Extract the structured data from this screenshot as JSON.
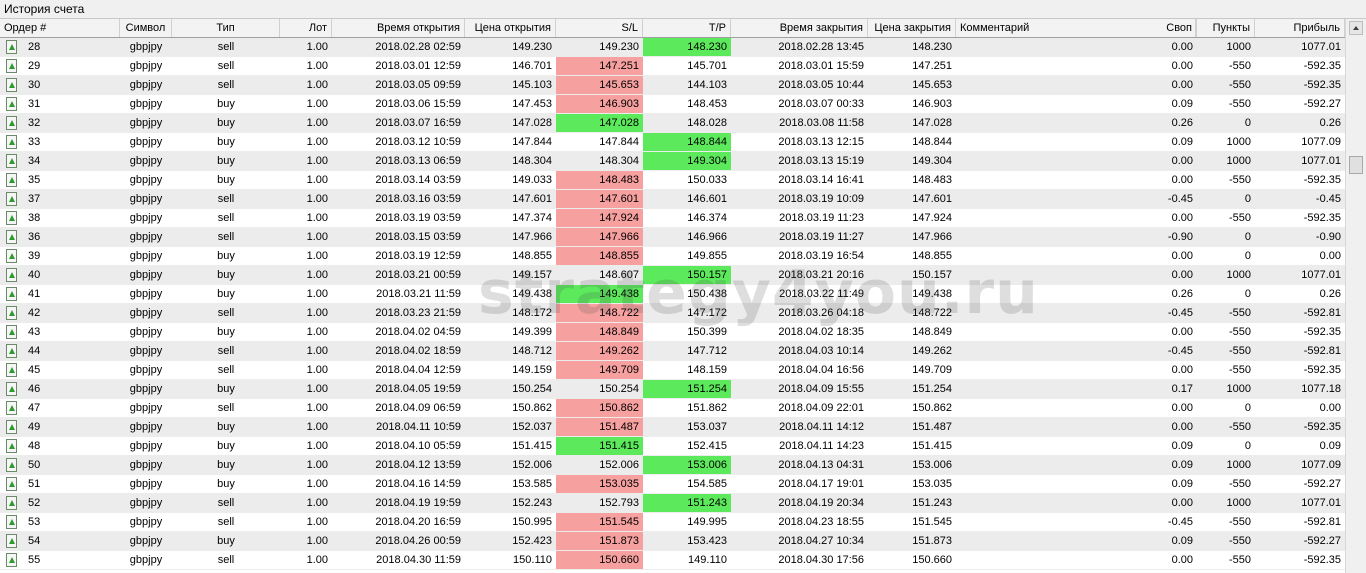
{
  "window": {
    "title": "История счета"
  },
  "columns": {
    "order": "Ордер #",
    "symbol": "Символ",
    "type": "Тип",
    "lot": "Лот",
    "open_time": "Время открытия",
    "open_price": "Цена открытия",
    "sl": "S/L",
    "tp": "T/P",
    "close_time": "Время закрытия",
    "close_price": "Цена закрытия",
    "comment": "Комментарий",
    "swap": "Своп",
    "points": "Пункты",
    "profit": "Прибыль"
  },
  "watermark": "strategy4you.ru",
  "colors": {
    "sl_hit": "#f7a0a0",
    "tp_hit": "#5cea5c",
    "alt_row": "#ececec"
  },
  "rows": [
    {
      "order": "28",
      "symbol": "gbpjpy",
      "type": "sell",
      "lot": "1.00",
      "open_time": "2018.02.28 02:59",
      "open_price": "149.230",
      "sl": "149.230",
      "tp": "148.230",
      "close_time": "2018.02.28 13:45",
      "close_price": "148.230",
      "comment": "",
      "swap": "0.00",
      "points": "1000",
      "profit": "1077.01",
      "sl_hl": "",
      "tp_hl": "green"
    },
    {
      "order": "29",
      "symbol": "gbpjpy",
      "type": "sell",
      "lot": "1.00",
      "open_time": "2018.03.01 12:59",
      "open_price": "146.701",
      "sl": "147.251",
      "tp": "145.701",
      "close_time": "2018.03.01 15:59",
      "close_price": "147.251",
      "comment": "",
      "swap": "0.00",
      "points": "-550",
      "profit": "-592.35",
      "sl_hl": "red",
      "tp_hl": ""
    },
    {
      "order": "30",
      "symbol": "gbpjpy",
      "type": "sell",
      "lot": "1.00",
      "open_time": "2018.03.05 09:59",
      "open_price": "145.103",
      "sl": "145.653",
      "tp": "144.103",
      "close_time": "2018.03.05 10:44",
      "close_price": "145.653",
      "comment": "",
      "swap": "0.00",
      "points": "-550",
      "profit": "-592.35",
      "sl_hl": "red",
      "tp_hl": ""
    },
    {
      "order": "31",
      "symbol": "gbpjpy",
      "type": "buy",
      "lot": "1.00",
      "open_time": "2018.03.06 15:59",
      "open_price": "147.453",
      "sl": "146.903",
      "tp": "148.453",
      "close_time": "2018.03.07 00:33",
      "close_price": "146.903",
      "comment": "",
      "swap": "0.09",
      "points": "-550",
      "profit": "-592.27",
      "sl_hl": "red",
      "tp_hl": ""
    },
    {
      "order": "32",
      "symbol": "gbpjpy",
      "type": "buy",
      "lot": "1.00",
      "open_time": "2018.03.07 16:59",
      "open_price": "147.028",
      "sl": "147.028",
      "tp": "148.028",
      "close_time": "2018.03.08 11:58",
      "close_price": "147.028",
      "comment": "",
      "swap": "0.26",
      "points": "0",
      "profit": "0.26",
      "sl_hl": "green",
      "tp_hl": ""
    },
    {
      "order": "33",
      "symbol": "gbpjpy",
      "type": "buy",
      "lot": "1.00",
      "open_time": "2018.03.12 10:59",
      "open_price": "147.844",
      "sl": "147.844",
      "tp": "148.844",
      "close_time": "2018.03.13 12:15",
      "close_price": "148.844",
      "comment": "",
      "swap": "0.09",
      "points": "1000",
      "profit": "1077.09",
      "sl_hl": "",
      "tp_hl": "green"
    },
    {
      "order": "34",
      "symbol": "gbpjpy",
      "type": "buy",
      "lot": "1.00",
      "open_time": "2018.03.13 06:59",
      "open_price": "148.304",
      "sl": "148.304",
      "tp": "149.304",
      "close_time": "2018.03.13 15:19",
      "close_price": "149.304",
      "comment": "",
      "swap": "0.00",
      "points": "1000",
      "profit": "1077.01",
      "sl_hl": "",
      "tp_hl": "green"
    },
    {
      "order": "35",
      "symbol": "gbpjpy",
      "type": "buy",
      "lot": "1.00",
      "open_time": "2018.03.14 03:59",
      "open_price": "149.033",
      "sl": "148.483",
      "tp": "150.033",
      "close_time": "2018.03.14 16:41",
      "close_price": "148.483",
      "comment": "",
      "swap": "0.00",
      "points": "-550",
      "profit": "-592.35",
      "sl_hl": "red",
      "tp_hl": ""
    },
    {
      "order": "37",
      "symbol": "gbpjpy",
      "type": "sell",
      "lot": "1.00",
      "open_time": "2018.03.16 03:59",
      "open_price": "147.601",
      "sl": "147.601",
      "tp": "146.601",
      "close_time": "2018.03.19 10:09",
      "close_price": "147.601",
      "comment": "",
      "swap": "-0.45",
      "points": "0",
      "profit": "-0.45",
      "sl_hl": "red",
      "tp_hl": ""
    },
    {
      "order": "38",
      "symbol": "gbpjpy",
      "type": "sell",
      "lot": "1.00",
      "open_time": "2018.03.19 03:59",
      "open_price": "147.374",
      "sl": "147.924",
      "tp": "146.374",
      "close_time": "2018.03.19 11:23",
      "close_price": "147.924",
      "comment": "",
      "swap": "0.00",
      "points": "-550",
      "profit": "-592.35",
      "sl_hl": "red",
      "tp_hl": ""
    },
    {
      "order": "36",
      "symbol": "gbpjpy",
      "type": "sell",
      "lot": "1.00",
      "open_time": "2018.03.15 03:59",
      "open_price": "147.966",
      "sl": "147.966",
      "tp": "146.966",
      "close_time": "2018.03.19 11:27",
      "close_price": "147.966",
      "comment": "",
      "swap": "-0.90",
      "points": "0",
      "profit": "-0.90",
      "sl_hl": "red",
      "tp_hl": ""
    },
    {
      "order": "39",
      "symbol": "gbpjpy",
      "type": "buy",
      "lot": "1.00",
      "open_time": "2018.03.19 12:59",
      "open_price": "148.855",
      "sl": "148.855",
      "tp": "149.855",
      "close_time": "2018.03.19 16:54",
      "close_price": "148.855",
      "comment": "",
      "swap": "0.00",
      "points": "0",
      "profit": "0.00",
      "sl_hl": "red",
      "tp_hl": ""
    },
    {
      "order": "40",
      "symbol": "gbpjpy",
      "type": "buy",
      "lot": "1.00",
      "open_time": "2018.03.21 00:59",
      "open_price": "149.157",
      "sl": "148.607",
      "tp": "150.157",
      "close_time": "2018.03.21 20:16",
      "close_price": "150.157",
      "comment": "",
      "swap": "0.00",
      "points": "1000",
      "profit": "1077.01",
      "sl_hl": "",
      "tp_hl": "green"
    },
    {
      "order": "41",
      "symbol": "gbpjpy",
      "type": "buy",
      "lot": "1.00",
      "open_time": "2018.03.21 11:59",
      "open_price": "149.438",
      "sl": "149.438",
      "tp": "150.438",
      "close_time": "2018.03.22 11:49",
      "close_price": "149.438",
      "comment": "",
      "swap": "0.26",
      "points": "0",
      "profit": "0.26",
      "sl_hl": "green",
      "tp_hl": ""
    },
    {
      "order": "42",
      "symbol": "gbpjpy",
      "type": "sell",
      "lot": "1.00",
      "open_time": "2018.03.23 21:59",
      "open_price": "148.172",
      "sl": "148.722",
      "tp": "147.172",
      "close_time": "2018.03.26 04:18",
      "close_price": "148.722",
      "comment": "",
      "swap": "-0.45",
      "points": "-550",
      "profit": "-592.81",
      "sl_hl": "red",
      "tp_hl": ""
    },
    {
      "order": "43",
      "symbol": "gbpjpy",
      "type": "buy",
      "lot": "1.00",
      "open_time": "2018.04.02 04:59",
      "open_price": "149.399",
      "sl": "148.849",
      "tp": "150.399",
      "close_time": "2018.04.02 18:35",
      "close_price": "148.849",
      "comment": "",
      "swap": "0.00",
      "points": "-550",
      "profit": "-592.35",
      "sl_hl": "red",
      "tp_hl": ""
    },
    {
      "order": "44",
      "symbol": "gbpjpy",
      "type": "sell",
      "lot": "1.00",
      "open_time": "2018.04.02 18:59",
      "open_price": "148.712",
      "sl": "149.262",
      "tp": "147.712",
      "close_time": "2018.04.03 10:14",
      "close_price": "149.262",
      "comment": "",
      "swap": "-0.45",
      "points": "-550",
      "profit": "-592.81",
      "sl_hl": "red",
      "tp_hl": ""
    },
    {
      "order": "45",
      "symbol": "gbpjpy",
      "type": "sell",
      "lot": "1.00",
      "open_time": "2018.04.04 12:59",
      "open_price": "149.159",
      "sl": "149.709",
      "tp": "148.159",
      "close_time": "2018.04.04 16:56",
      "close_price": "149.709",
      "comment": "",
      "swap": "0.00",
      "points": "-550",
      "profit": "-592.35",
      "sl_hl": "red",
      "tp_hl": ""
    },
    {
      "order": "46",
      "symbol": "gbpjpy",
      "type": "buy",
      "lot": "1.00",
      "open_time": "2018.04.05 19:59",
      "open_price": "150.254",
      "sl": "150.254",
      "tp": "151.254",
      "close_time": "2018.04.09 15:55",
      "close_price": "151.254",
      "comment": "",
      "swap": "0.17",
      "points": "1000",
      "profit": "1077.18",
      "sl_hl": "",
      "tp_hl": "green"
    },
    {
      "order": "47",
      "symbol": "gbpjpy",
      "type": "sell",
      "lot": "1.00",
      "open_time": "2018.04.09 06:59",
      "open_price": "150.862",
      "sl": "150.862",
      "tp": "151.862",
      "close_time": "2018.04.09 22:01",
      "close_price": "150.862",
      "comment": "",
      "swap": "0.00",
      "points": "0",
      "profit": "0.00",
      "sl_hl": "red",
      "tp_hl": ""
    },
    {
      "order": "49",
      "symbol": "gbpjpy",
      "type": "buy",
      "lot": "1.00",
      "open_time": "2018.04.11 10:59",
      "open_price": "152.037",
      "sl": "151.487",
      "tp": "153.037",
      "close_time": "2018.04.11 14:12",
      "close_price": "151.487",
      "comment": "",
      "swap": "0.00",
      "points": "-550",
      "profit": "-592.35",
      "sl_hl": "red",
      "tp_hl": ""
    },
    {
      "order": "48",
      "symbol": "gbpjpy",
      "type": "buy",
      "lot": "1.00",
      "open_time": "2018.04.10 05:59",
      "open_price": "151.415",
      "sl": "151.415",
      "tp": "152.415",
      "close_time": "2018.04.11 14:23",
      "close_price": "151.415",
      "comment": "",
      "swap": "0.09",
      "points": "0",
      "profit": "0.09",
      "sl_hl": "green",
      "tp_hl": ""
    },
    {
      "order": "50",
      "symbol": "gbpjpy",
      "type": "buy",
      "lot": "1.00",
      "open_time": "2018.04.12 13:59",
      "open_price": "152.006",
      "sl": "152.006",
      "tp": "153.006",
      "close_time": "2018.04.13 04:31",
      "close_price": "153.006",
      "comment": "",
      "swap": "0.09",
      "points": "1000",
      "profit": "1077.09",
      "sl_hl": "",
      "tp_hl": "green"
    },
    {
      "order": "51",
      "symbol": "gbpjpy",
      "type": "buy",
      "lot": "1.00",
      "open_time": "2018.04.16 14:59",
      "open_price": "153.585",
      "sl": "153.035",
      "tp": "154.585",
      "close_time": "2018.04.17 19:01",
      "close_price": "153.035",
      "comment": "",
      "swap": "0.09",
      "points": "-550",
      "profit": "-592.27",
      "sl_hl": "red",
      "tp_hl": ""
    },
    {
      "order": "52",
      "symbol": "gbpjpy",
      "type": "sell",
      "lot": "1.00",
      "open_time": "2018.04.19 19:59",
      "open_price": "152.243",
      "sl": "152.793",
      "tp": "151.243",
      "close_time": "2018.04.19 20:34",
      "close_price": "151.243",
      "comment": "",
      "swap": "0.00",
      "points": "1000",
      "profit": "1077.01",
      "sl_hl": "",
      "tp_hl": "green"
    },
    {
      "order": "53",
      "symbol": "gbpjpy",
      "type": "sell",
      "lot": "1.00",
      "open_time": "2018.04.20 16:59",
      "open_price": "150.995",
      "sl": "151.545",
      "tp": "149.995",
      "close_time": "2018.04.23 18:55",
      "close_price": "151.545",
      "comment": "",
      "swap": "-0.45",
      "points": "-550",
      "profit": "-592.81",
      "sl_hl": "red",
      "tp_hl": ""
    },
    {
      "order": "54",
      "symbol": "gbpjpy",
      "type": "buy",
      "lot": "1.00",
      "open_time": "2018.04.26 00:59",
      "open_price": "152.423",
      "sl": "151.873",
      "tp": "153.423",
      "close_time": "2018.04.27 10:34",
      "close_price": "151.873",
      "comment": "",
      "swap": "0.09",
      "points": "-550",
      "profit": "-592.27",
      "sl_hl": "red",
      "tp_hl": ""
    },
    {
      "order": "55",
      "symbol": "gbpjpy",
      "type": "sell",
      "lot": "1.00",
      "open_time": "2018.04.30 11:59",
      "open_price": "150.110",
      "sl": "150.660",
      "tp": "149.110",
      "close_time": "2018.04.30 17:56",
      "close_price": "150.660",
      "comment": "",
      "swap": "0.00",
      "points": "-550",
      "profit": "-592.35",
      "sl_hl": "red",
      "tp_hl": ""
    }
  ]
}
